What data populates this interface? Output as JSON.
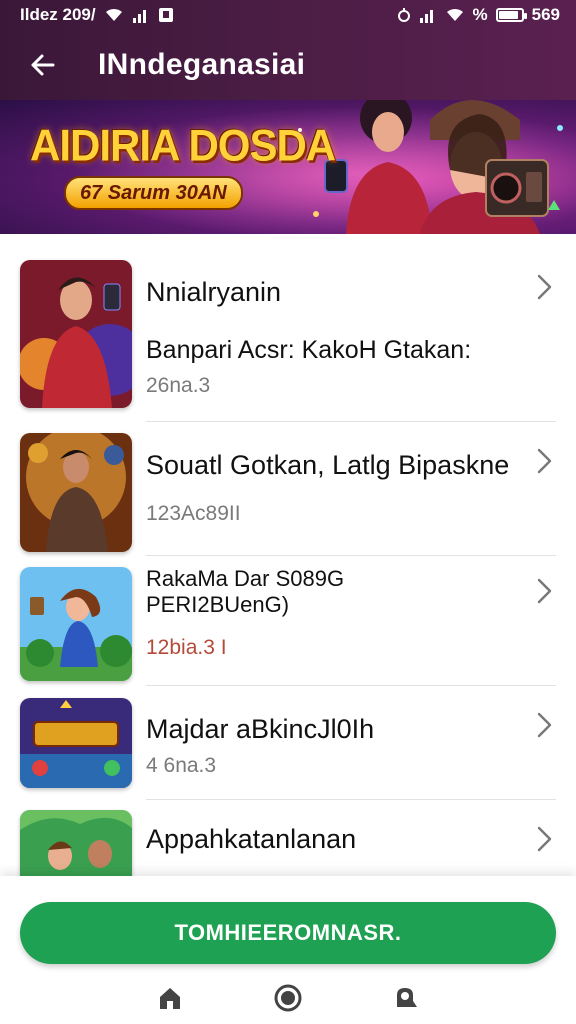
{
  "status_bar": {
    "left_text": "Ildez 209/",
    "right_text": "%",
    "battery_level": 0.85,
    "right_time": "569"
  },
  "app_bar": {
    "title": "INndeganasiai",
    "back_icon": "arrow-left-icon"
  },
  "banner": {
    "title": "AIDIRIA DOSDA",
    "badge": "67 Sarum 30AN"
  },
  "items": [
    {
      "title": "Nnialryanin",
      "subtitle": "Banpari Acsr: KakoH Gtakan:",
      "meta": "26na.3"
    },
    {
      "title": "Souatl Gotkan, Latlg Bipaskne",
      "subtitle": "",
      "meta": "123Ac89II"
    },
    {
      "title": "RakaMa Dar S089G",
      "subtitle": "PERI2BUenG)",
      "meta": "12bia.3 I"
    },
    {
      "title": "Majdar aBkincJl0Ih",
      "subtitle": "",
      "meta": "4 6na.3"
    },
    {
      "title": "Appahkatanlanan",
      "subtitle": "",
      "meta": ""
    }
  ],
  "cta": {
    "label": "TOMHIEEROMNASR."
  },
  "nav": {
    "icons": [
      "home-icon",
      "circle-button-icon",
      "search-icon"
    ]
  },
  "colors": {
    "header_bg": "#3a1738",
    "cta_green": "#1ea152",
    "meta_gray": "#7a7a7a"
  }
}
